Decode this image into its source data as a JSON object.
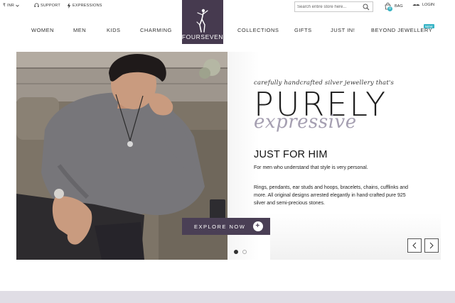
{
  "topbar": {
    "currency": "INR",
    "support": "SUPPORT",
    "expressions": "EXPRESSIONS",
    "search_placeholder": "Search entire store here...",
    "bag_count": "0",
    "bag_label": "BAG",
    "login_label": "LOGIN"
  },
  "logo": {
    "text": "FOURSEVEN"
  },
  "nav": {
    "women": "WOMEN",
    "men": "MEN",
    "kids": "KIDS",
    "charming": "CHARMING",
    "collections": "COLLECTIONS",
    "gifts": "GIFTS",
    "just_in": "JUST IN!",
    "beyond": "BEYOND JEWELLERY",
    "new_badge": "NEW"
  },
  "hero": {
    "tagline": "carefully handcrafted silver jewellery that's",
    "headline": "PURELY",
    "script": "expressive",
    "subheading": "JUST FOR HIM",
    "description1": "For men who understand that style is very personal.",
    "description2": "Rings, pendants, ear studs and hoops, bracelets, chains, cufflinks and more. All original designs arrested elegantly in hand-crafted pure 925 silver and semi-precious stones.",
    "cta": "EXPLORE NOW",
    "cta_icon": "+"
  },
  "carousel": {
    "slide_count": 2,
    "active_slide": 1
  },
  "colors": {
    "brand": "#463a4f",
    "accent": "#a59fb1",
    "badge": "#35b3c5"
  }
}
